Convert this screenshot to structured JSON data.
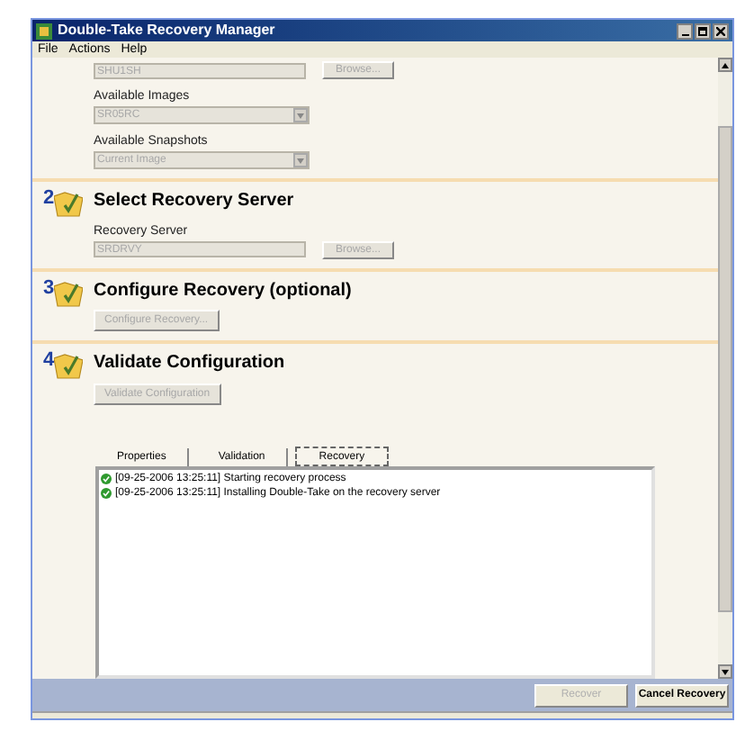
{
  "window": {
    "title": "Double-Take Recovery Manager"
  },
  "menu": [
    {
      "label": "File"
    },
    {
      "label": "Actions"
    },
    {
      "label": "Help"
    }
  ],
  "sections": [
    {
      "items": [
        {
          "kind": "field",
          "value": "SHU1SH",
          "disabled": true,
          "button": {
            "label": "Browse...",
            "disabled": true
          }
        },
        {
          "kind": "label",
          "text": "Available Images"
        },
        {
          "kind": "dropdown",
          "value": "SR05RC",
          "disabled": true
        },
        {
          "kind": "label",
          "text": "Available Snapshots"
        },
        {
          "kind": "dropdown",
          "value": "Current Image",
          "disabled": true
        }
      ]
    },
    {
      "number": "2",
      "title": "Select Recovery Server",
      "items": [
        {
          "kind": "label",
          "text": "Recovery Server"
        },
        {
          "kind": "field",
          "value": "SRDRVY",
          "disabled": true,
          "button": {
            "label": "Browse...",
            "disabled": true
          }
        }
      ]
    },
    {
      "number": "3",
      "title": "Configure Recovery (optional)",
      "items": [
        {
          "kind": "button",
          "label": "Configure Recovery...",
          "disabled": true
        }
      ]
    },
    {
      "number": "4",
      "title": "Validate Configuration",
      "items": [
        {
          "kind": "button",
          "label": "Validate Configuration",
          "disabled": true
        }
      ]
    }
  ],
  "tabs": [
    {
      "label": "Properties",
      "selected": false
    },
    {
      "label": "Validation",
      "selected": false
    },
    {
      "label": "Recovery",
      "selected": true
    }
  ],
  "log": [
    {
      "success": true,
      "text": "[09-25-2006 13:25:11] Starting recovery process"
    },
    {
      "success": true,
      "text": "[09-25-2006 13:25:11] Installing Double-Take on the recovery server"
    }
  ],
  "buttons": [
    {
      "label": "Recover",
      "disabled": true
    },
    {
      "label": "Cancel Recovery",
      "disabled": false
    }
  ]
}
